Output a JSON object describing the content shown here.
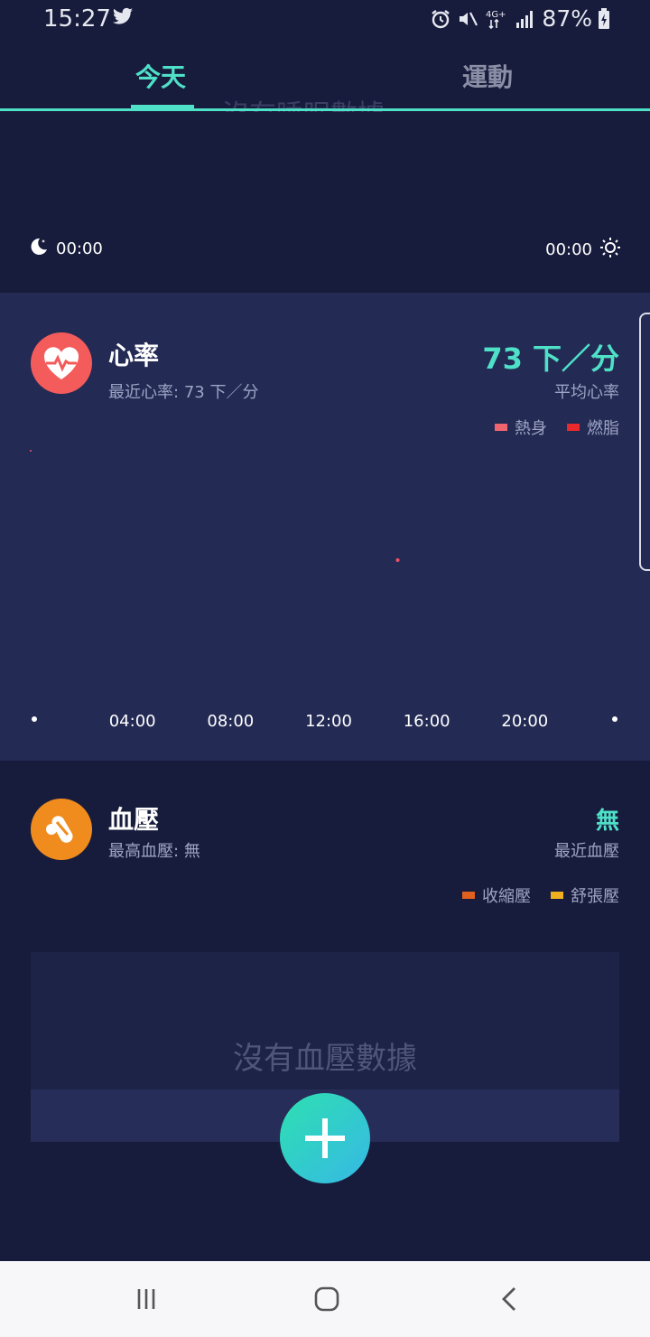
{
  "status_bar": {
    "time": "15:27",
    "left_icon": "twitter-icon",
    "network": "4G+",
    "battery": "87%"
  },
  "tabs": [
    {
      "label": "今天",
      "active": true
    },
    {
      "label": "運動",
      "active": false
    }
  ],
  "sleep": {
    "clipped_empty_text": "沒有睡眠數據",
    "start_time": "00:00",
    "end_time": "00:00"
  },
  "heart_rate": {
    "title": "心率",
    "recent_label": "最近心率:",
    "recent_value": "73 下／分",
    "avg_value": "73 下／分",
    "avg_label": "平均心率",
    "legend": [
      {
        "label": "熱身",
        "color": "#f06470"
      },
      {
        "label": "燃脂",
        "color": "#e82a2a"
      }
    ],
    "chart_data": {
      "type": "scatter",
      "x_ticks": [
        "04:00",
        "08:00",
        "12:00",
        "16:00",
        "20:00"
      ],
      "points": [
        {
          "hour": 0.0,
          "bpm": 73
        },
        {
          "hour": 15.0,
          "bpm": 73
        }
      ]
    }
  },
  "blood_pressure": {
    "title": "血壓",
    "max_label": "最高血壓:",
    "max_value": "無",
    "recent_value": "無",
    "recent_label": "最近血壓",
    "legend": [
      {
        "label": "收縮壓",
        "color": "#e0601e"
      },
      {
        "label": "舒張壓",
        "color": "#f0b020"
      }
    ],
    "empty_text": "沒有血壓數據"
  },
  "colors": {
    "accent": "#4fe0c8",
    "background": "#181c3c",
    "card": "#232a54",
    "heart_icon_bg": "#f45b5b",
    "bp_icon_bg": "#f08c1e"
  }
}
